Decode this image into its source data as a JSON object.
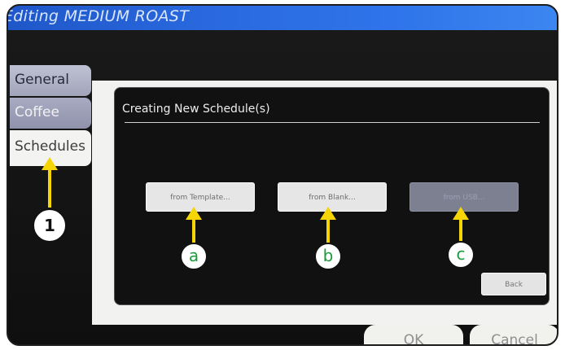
{
  "window": {
    "title": "Editing MEDIUM ROAST"
  },
  "sidebar": {
    "tabs": [
      {
        "label": "General"
      },
      {
        "label": "Coffee"
      },
      {
        "label": "Schedules",
        "selected": true
      }
    ]
  },
  "dialog": {
    "title": "Creating New Schedule(s)",
    "options": [
      {
        "label": "from Template...",
        "enabled": true
      },
      {
        "label": "from Blank...",
        "enabled": true
      },
      {
        "label": "from USB...",
        "enabled": false
      }
    ],
    "back_label": "Back"
  },
  "footer": {
    "ok_label": "OK",
    "cancel_label": "Cancel"
  },
  "annotations": {
    "step": "1",
    "callouts": [
      "a",
      "b",
      "c"
    ],
    "arrow_color": "#f5d506",
    "callout_letter_color": "#1b9b3c"
  },
  "colors": {
    "titlebar": "#2a6ae0",
    "selected_tab": "#f3f3f1",
    "dialog_bg": "#111111"
  }
}
